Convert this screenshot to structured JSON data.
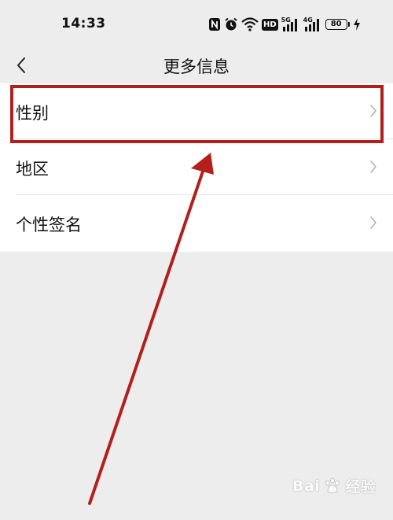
{
  "status_bar": {
    "time": "14:33",
    "icons": [
      "nfc-icon",
      "alarm-icon",
      "wifi-icon",
      "hd-icon",
      "signal-5g-icon",
      "signal-4g-icon",
      "battery-icon",
      "charging-icon"
    ],
    "hd_label": "HD",
    "net1_label": "5G",
    "net2_label": "4G",
    "battery_level": "80"
  },
  "nav": {
    "title": "更多信息",
    "back_icon": "chevron-left-icon"
  },
  "list": {
    "items": [
      {
        "label": "性别"
      },
      {
        "label": "地区"
      },
      {
        "label": "个性签名"
      }
    ],
    "chevron_icon": "chevron-right-icon"
  },
  "annotation": {
    "highlight_color": "#b3201c",
    "arrow_color": "#b3201c"
  },
  "watermark": {
    "brand": "Bai",
    "brand_suffix": "经验"
  }
}
